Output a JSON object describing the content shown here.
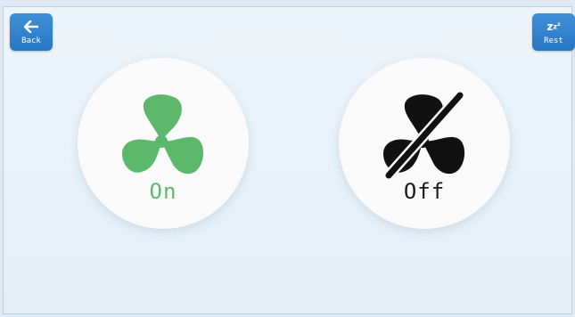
{
  "buttons": {
    "back_label": "Back",
    "rest_label": "Rest"
  },
  "fan": {
    "on_label": "On",
    "off_label": "Off"
  },
  "icons": {
    "back": "arrow-left-icon",
    "rest": "zzz-sleep-icon",
    "fan_on": "fan-icon",
    "fan_off": "fan-off-icon"
  },
  "colors": {
    "accent_blue": "#2f82cf",
    "fan_on_green": "#5cb96c",
    "fan_off_black": "#111111"
  }
}
